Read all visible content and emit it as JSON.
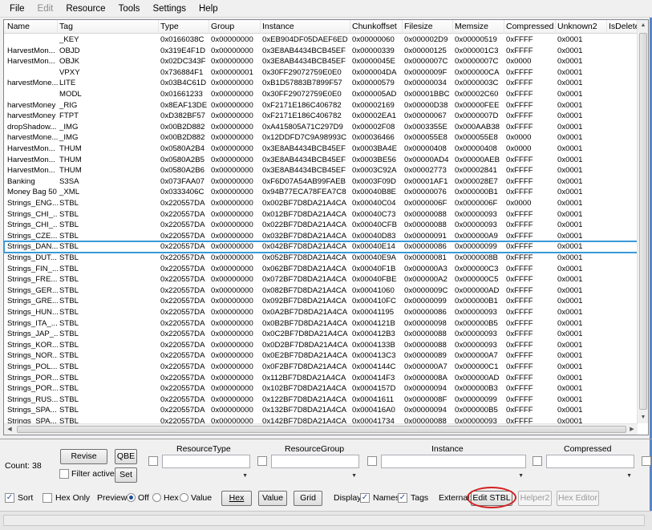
{
  "menu": [
    "File",
    "Edit",
    "Resource",
    "Tools",
    "Settings",
    "Help"
  ],
  "columns": [
    "Name",
    "Tag",
    "Type",
    "Group",
    "Instance",
    "Chunkoffset",
    "Filesize",
    "Memsize",
    "Compressed",
    "Unknown2",
    "IsDeleted"
  ],
  "rows": [
    [
      "",
      "_KEY",
      "0x0166038C",
      "0x00000000",
      "0xEB904DF05DAEF6ED",
      "0x00000060",
      "0x000002D9",
      "0x00000519",
      "0xFFFF",
      "0x0001"
    ],
    [
      "HarvestMon...",
      "OBJD",
      "0x319E4F1D",
      "0x00000000",
      "0x3E8AB4434BCB45EF",
      "0x00000339",
      "0x00000125",
      "0x000001C3",
      "0xFFFF",
      "0x0001"
    ],
    [
      "HarvestMon...",
      "OBJK",
      "0x02DC343F",
      "0x00000000",
      "0x3E8AB4434BCB45EF",
      "0x0000045E",
      "0x0000007C",
      "0x0000007C",
      "0x0000",
      "0x0001"
    ],
    [
      "",
      "VPXY",
      "0x736884F1",
      "0x00000001",
      "0x30FF29072759E0E0",
      "0x000004DA",
      "0x0000009F",
      "0x000000CA",
      "0xFFFF",
      "0x0001"
    ],
    [
      "harvestMone...",
      "LITE",
      "0x03B4C61D",
      "0x00000000",
      "0xB1D57883B7899F57",
      "0x00000579",
      "0x00000034",
      "0x0000003C",
      "0xFFFF",
      "0x0001"
    ],
    [
      "",
      "MODL",
      "0x01661233",
      "0x00000000",
      "0x30FF29072759E0E0",
      "0x000005AD",
      "0x00001BBC",
      "0x00002C60",
      "0xFFFF",
      "0x0001"
    ],
    [
      "harvestMoney",
      "_RIG",
      "0x8EAF13DE",
      "0x00000000",
      "0xF2171E186C406782",
      "0x00002169",
      "0x00000D38",
      "0x00000FEE",
      "0xFFFF",
      "0x0001"
    ],
    [
      "harvestMoney",
      "FTPT",
      "0xD382BF57",
      "0x00000000",
      "0xF2171E186C406782",
      "0x00002EA1",
      "0x00000067",
      "0x0000007D",
      "0xFFFF",
      "0x0001"
    ],
    [
      "dropShadow...",
      "_IMG",
      "0x00B2D882",
      "0x00000000",
      "0xA415805A71C297D9",
      "0x00002F08",
      "0x0003355E",
      "0x000AAB38",
      "0xFFFF",
      "0x0001"
    ],
    [
      "harvestMone...",
      "_IMG",
      "0x00B2D882",
      "0x00000000",
      "0x12DDFD7C9A98993C",
      "0x00036466",
      "0x000055E8",
      "0x000055E8",
      "0x0000",
      "0x0001"
    ],
    [
      "HarvestMon...",
      "THUM",
      "0x0580A2B4",
      "0x00000000",
      "0x3E8AB4434BCB45EF",
      "0x0003BA4E",
      "0x00000408",
      "0x00000408",
      "0x0000",
      "0x0001"
    ],
    [
      "HarvestMon...",
      "THUM",
      "0x0580A2B5",
      "0x00000000",
      "0x3E8AB4434BCB45EF",
      "0x0003BE56",
      "0x00000AD4",
      "0x00000AEB",
      "0xFFFF",
      "0x0001"
    ],
    [
      "HarvestMon...",
      "THUM",
      "0x0580A2B6",
      "0x00000000",
      "0x3E8AB4434BCB45EF",
      "0x0003C92A",
      "0x00002773",
      "0x00002841",
      "0xFFFF",
      "0x0001"
    ],
    [
      "Banking",
      "S3SA",
      "0x073FAA07",
      "0x00000000",
      "0xF6D07A54AB99FAEB",
      "0x0003F09D",
      "0x00001AF1",
      "0x000028E7",
      "0xFFFF",
      "0x0001"
    ],
    [
      "Money Bag 50",
      "_XML",
      "0x0333406C",
      "0x00000000",
      "0x94B77ECA78FEA7C8",
      "0x00040B8E",
      "0x00000076",
      "0x000000B1",
      "0xFFFF",
      "0x0001"
    ],
    [
      "Strings_ENG...",
      "STBL",
      "0x220557DA",
      "0x00000000",
      "0x002BF7D8DA21A4CA",
      "0x00040C04",
      "0x0000006F",
      "0x0000006F",
      "0x0000",
      "0x0001"
    ],
    [
      "Strings_CHI_...",
      "STBL",
      "0x220557DA",
      "0x00000000",
      "0x012BF7D8DA21A4CA",
      "0x00040C73",
      "0x00000088",
      "0x00000093",
      "0xFFFF",
      "0x0001"
    ],
    [
      "Strings_CHI_...",
      "STBL",
      "0x220557DA",
      "0x00000000",
      "0x022BF7D8DA21A4CA",
      "0x00040CFB",
      "0x00000088",
      "0x00000093",
      "0xFFFF",
      "0x0001"
    ],
    [
      "Strings_CZE...",
      "STBL",
      "0x220557DA",
      "0x00000000",
      "0x032BF7D8DA21A4CA",
      "0x00040D83",
      "0x00000091",
      "0x000000A9",
      "0xFFFF",
      "0x0001"
    ],
    [
      "Strings_DAN...",
      "STBL",
      "0x220557DA",
      "0x00000000",
      "0x042BF7D8DA21A4CA",
      "0x00040E14",
      "0x00000086",
      "0x00000099",
      "0xFFFF",
      "0x0001"
    ],
    [
      "Strings_DUT...",
      "STBL",
      "0x220557DA",
      "0x00000000",
      "0x052BF7D8DA21A4CA",
      "0x00040E9A",
      "0x00000081",
      "0x0000008B",
      "0xFFFF",
      "0x0001"
    ],
    [
      "Strings_FIN_...",
      "STBL",
      "0x220557DA",
      "0x00000000",
      "0x062BF7D8DA21A4CA",
      "0x00040F1B",
      "0x000000A3",
      "0x000000C3",
      "0xFFFF",
      "0x0001"
    ],
    [
      "Strings_FRE...",
      "STBL",
      "0x220557DA",
      "0x00000000",
      "0x072BF7D8DA21A4CA",
      "0x00040FBE",
      "0x000000A2",
      "0x000000C5",
      "0xFFFF",
      "0x0001"
    ],
    [
      "Strings_GER...",
      "STBL",
      "0x220557DA",
      "0x00000000",
      "0x082BF7D8DA21A4CA",
      "0x00041060",
      "0x0000009C",
      "0x000000AD",
      "0xFFFF",
      "0x0001"
    ],
    [
      "Strings_GRE...",
      "STBL",
      "0x220557DA",
      "0x00000000",
      "0x092BF7D8DA21A4CA",
      "0x000410FC",
      "0x00000099",
      "0x000000B1",
      "0xFFFF",
      "0x0001"
    ],
    [
      "Strings_HUN...",
      "STBL",
      "0x220557DA",
      "0x00000000",
      "0x0A2BF7D8DA21A4CA",
      "0x00041195",
      "0x00000086",
      "0x00000093",
      "0xFFFF",
      "0x0001"
    ],
    [
      "Strings_ITA_...",
      "STBL",
      "0x220557DA",
      "0x00000000",
      "0x0B2BF7D8DA21A4CA",
      "0x0004121B",
      "0x00000098",
      "0x000000B5",
      "0xFFFF",
      "0x0001"
    ],
    [
      "Strings_JAP_...",
      "STBL",
      "0x220557DA",
      "0x00000000",
      "0x0C2BF7D8DA21A4CA",
      "0x000412B3",
      "0x00000088",
      "0x00000093",
      "0xFFFF",
      "0x0001"
    ],
    [
      "Strings_KOR...",
      "STBL",
      "0x220557DA",
      "0x00000000",
      "0x0D2BF7D8DA21A4CA",
      "0x0004133B",
      "0x00000088",
      "0x00000093",
      "0xFFFF",
      "0x0001"
    ],
    [
      "Strings_NOR...",
      "STBL",
      "0x220557DA",
      "0x00000000",
      "0x0E2BF7D8DA21A4CA",
      "0x000413C3",
      "0x00000089",
      "0x000000A7",
      "0xFFFF",
      "0x0001"
    ],
    [
      "Strings_POL...",
      "STBL",
      "0x220557DA",
      "0x00000000",
      "0x0F2BF7D8DA21A4CA",
      "0x0004144C",
      "0x000000A7",
      "0x000000C1",
      "0xFFFF",
      "0x0001"
    ],
    [
      "Strings_POR...",
      "STBL",
      "0x220557DA",
      "0x00000000",
      "0x112BF7D8DA21A4CA",
      "0x000414F3",
      "0x0000008A",
      "0x000000AD",
      "0xFFFF",
      "0x0001"
    ],
    [
      "Strings_POR...",
      "STBL",
      "0x220557DA",
      "0x00000000",
      "0x102BF7D8DA21A4CA",
      "0x0004157D",
      "0x00000094",
      "0x000000B3",
      "0xFFFF",
      "0x0001"
    ],
    [
      "Strings_RUS...",
      "STBL",
      "0x220557DA",
      "0x00000000",
      "0x122BF7D8DA21A4CA",
      "0x00041611",
      "0x0000008F",
      "0x00000099",
      "0xFFFF",
      "0x0001"
    ],
    [
      "Strings_SPA...",
      "STBL",
      "0x220557DA",
      "0x00000000",
      "0x132BF7D8DA21A4CA",
      "0x000416A0",
      "0x00000094",
      "0x000000B5",
      "0xFFFF",
      "0x0001"
    ],
    [
      "Strings_SPA...",
      "STBL",
      "0x220557DA",
      "0x00000000",
      "0x142BF7D8DA21A4CA",
      "0x00041734",
      "0x00000088",
      "0x00000093",
      "0xFFFF",
      "0x0001"
    ]
  ],
  "selected_row": "Strings_DAN...",
  "colors": {
    "selection": "#3a9ad9",
    "highlight": "#d41f1f"
  },
  "icons": {
    "scroll_up": "scroll-up-arrow",
    "scroll_down": "scroll-down-arrow",
    "scroll_left": "scroll-left-arrow",
    "scroll_right": "scroll-right-arrow",
    "dropdown": "chevron-down"
  },
  "panel": {
    "count_label": "Count:",
    "count_value": "38",
    "revise": "Revise",
    "qbe": "QBE",
    "filter_active": "Filter active",
    "set": "Set",
    "filter_headers": [
      "ResourceType",
      "ResourceGroup",
      "Instance",
      "Compressed"
    ],
    "sort": "Sort",
    "hex_only": "Hex Only",
    "preview_label": "Preview:",
    "preview_off": "Off",
    "preview_hex": "Hex",
    "preview_value": "Value",
    "btn_hex": "Hex",
    "btn_value": "Value",
    "btn_grid": "Grid",
    "display_label": "Display:",
    "names": "Names",
    "tags": "Tags",
    "external_label": "External:",
    "edit_stbl": "Edit STBL",
    "helper2": "Helper2",
    "hex_editor": "Hex Editor",
    "check_mark": "✓"
  }
}
